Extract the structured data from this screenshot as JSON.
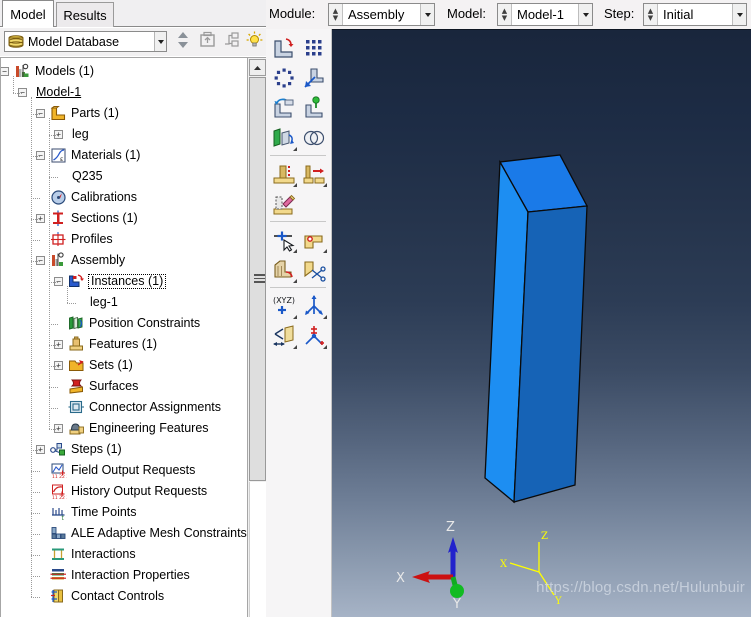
{
  "app": {
    "name": "Abaqus/CAE",
    "watermark": "https://blog.csdn.net/Hulunbuir"
  },
  "tabs": [
    {
      "label": "Model",
      "active": true
    },
    {
      "label": "Results",
      "active": false
    }
  ],
  "model_database_bar": {
    "combo_value": "Model Database",
    "combo_icon": "database-icon",
    "buttons": [
      {
        "name": "updown-arrows-button",
        "icon": "up-down-arrows-icon"
      },
      {
        "name": "parent-folder-button",
        "icon": "folder-up-icon"
      },
      {
        "name": "link-tree-button",
        "icon": "tree-link-icon"
      },
      {
        "name": "tip-light-button",
        "icon": "lightbulb-icon"
      }
    ]
  },
  "tree": {
    "items": [
      {
        "label": "Models (1)",
        "depth": 0,
        "expander": "minus",
        "icon": "models-icon",
        "style": ""
      },
      {
        "label": "Model-1",
        "depth": 1,
        "expander": "minus",
        "icon": "none",
        "style": "underline"
      },
      {
        "label": "Parts (1)",
        "depth": 2,
        "expander": "minus",
        "icon": "parts-icon",
        "style": ""
      },
      {
        "label": "leg",
        "depth": 3,
        "expander": "plus",
        "icon": "none",
        "style": ""
      },
      {
        "label": "Materials (1)",
        "depth": 2,
        "expander": "minus",
        "icon": "materials-icon",
        "style": ""
      },
      {
        "label": "Q235",
        "depth": 3,
        "expander": "none",
        "icon": "none",
        "style": ""
      },
      {
        "label": "Calibrations",
        "depth": 2,
        "expander": "none",
        "icon": "calibrations-icon",
        "style": ""
      },
      {
        "label": "Sections (1)",
        "depth": 2,
        "expander": "plus",
        "icon": "sections-icon",
        "style": ""
      },
      {
        "label": "Profiles",
        "depth": 2,
        "expander": "none",
        "icon": "profiles-icon",
        "style": ""
      },
      {
        "label": "Assembly",
        "depth": 2,
        "expander": "minus",
        "icon": "assembly-icon",
        "style": ""
      },
      {
        "label": "Instances (1)",
        "depth": 3,
        "expander": "minus",
        "icon": "instances-icon",
        "style": "dashbox"
      },
      {
        "label": "leg-1",
        "depth": 4,
        "expander": "none",
        "icon": "none",
        "style": ""
      },
      {
        "label": "Position Constraints",
        "depth": 3,
        "expander": "none",
        "icon": "position-constraints-icon",
        "style": ""
      },
      {
        "label": "Features (1)",
        "depth": 3,
        "expander": "plus",
        "icon": "features-icon",
        "style": ""
      },
      {
        "label": "Sets (1)",
        "depth": 3,
        "expander": "plus",
        "icon": "sets-icon",
        "style": ""
      },
      {
        "label": "Surfaces",
        "depth": 3,
        "expander": "none",
        "icon": "surfaces-icon",
        "style": ""
      },
      {
        "label": "Connector Assignments",
        "depth": 3,
        "expander": "none",
        "icon": "connector-assignments-icon",
        "style": ""
      },
      {
        "label": "Engineering Features",
        "depth": 3,
        "expander": "plus",
        "icon": "engineering-features-icon",
        "style": ""
      },
      {
        "label": "Steps (1)",
        "depth": 2,
        "expander": "plus",
        "icon": "steps-icon",
        "style": ""
      },
      {
        "label": "Field Output Requests",
        "depth": 2,
        "expander": "none",
        "icon": "field-output-icon",
        "style": ""
      },
      {
        "label": "History Output Requests",
        "depth": 2,
        "expander": "none",
        "icon": "history-output-icon",
        "style": ""
      },
      {
        "label": "Time Points",
        "depth": 2,
        "expander": "none",
        "icon": "time-points-icon",
        "style": ""
      },
      {
        "label": "ALE Adaptive Mesh Constraints",
        "depth": 2,
        "expander": "none",
        "icon": "ale-mesh-icon",
        "style": ""
      },
      {
        "label": "Interactions",
        "depth": 2,
        "expander": "none",
        "icon": "interactions-icon",
        "style": ""
      },
      {
        "label": "Interaction Properties",
        "depth": 2,
        "expander": "none",
        "icon": "interaction-properties-icon",
        "style": ""
      },
      {
        "label": "Contact Controls",
        "depth": 2,
        "expander": "none",
        "icon": "contact-controls-icon",
        "style": ""
      }
    ]
  },
  "top_bar": {
    "module": {
      "label": "Module:",
      "value": "Assembly"
    },
    "model": {
      "label": "Model:",
      "value": "Model-1"
    },
    "step": {
      "label": "Step:",
      "value": "Initial"
    }
  },
  "module_toolbar": {
    "groups": [
      {
        "buttons": [
          {
            "name": "create-instance-button",
            "icon": "create-instance-icon"
          },
          {
            "name": "linear-pattern-button",
            "icon": "linear-pattern-icon"
          },
          {
            "name": "radial-pattern-button",
            "icon": "radial-pattern-icon"
          },
          {
            "name": "translate-instance-button",
            "icon": "translate-instance-icon"
          },
          {
            "name": "rotate-instance-button",
            "icon": "rotate-instance-icon"
          },
          {
            "name": "translate-to-button",
            "icon": "translate-to-icon"
          },
          {
            "name": "face-to-face-button",
            "icon": "face-to-face-icon"
          },
          {
            "name": "merge-cut-button",
            "icon": "merge-cut-icon"
          }
        ]
      },
      {
        "buttons": [
          {
            "name": "create-constraint-button",
            "icon": "create-constraint-icon"
          },
          {
            "name": "edit-constraint-button",
            "icon": "edit-constraint-icon"
          },
          {
            "name": "delete-constraint-button",
            "icon": "delete-constraint-icon"
          }
        ]
      },
      {
        "buttons": [
          {
            "name": "create-set-button",
            "icon": "create-set-icon"
          },
          {
            "name": "create-surface-button",
            "icon": "create-surface-icon"
          },
          {
            "name": "partition-cell-button",
            "icon": "partition-cell-icon"
          },
          {
            "name": "cut-partition-button",
            "icon": "cut-partition-icon"
          }
        ]
      },
      {
        "buttons": [
          {
            "name": "create-datum-point-button",
            "icon": "datum-xyz-icon"
          },
          {
            "name": "create-datum-axis-button",
            "icon": "datum-axis-icon"
          },
          {
            "name": "create-datum-plane-button",
            "icon": "datum-plane-icon"
          },
          {
            "name": "create-datum-csys-button",
            "icon": "datum-csys-icon"
          }
        ]
      }
    ]
  },
  "viewport": {
    "part_triad": {
      "x": "X",
      "y": "Y",
      "z": "Z"
    },
    "global_triad": {
      "x": "X",
      "y": "Y",
      "z": "Z"
    },
    "colors": {
      "background_top": "#19263c",
      "background_bottom": "#a6b3c6",
      "face_top": "#1a7ae8",
      "face_left": "#1d8ef2",
      "face_front": "#1663b6",
      "edge": "#0a0a0a",
      "part_triad": "#ffff00",
      "axis_x": "#cc1111",
      "axis_y": "#11aa22",
      "axis_z": "#2222cc"
    }
  }
}
